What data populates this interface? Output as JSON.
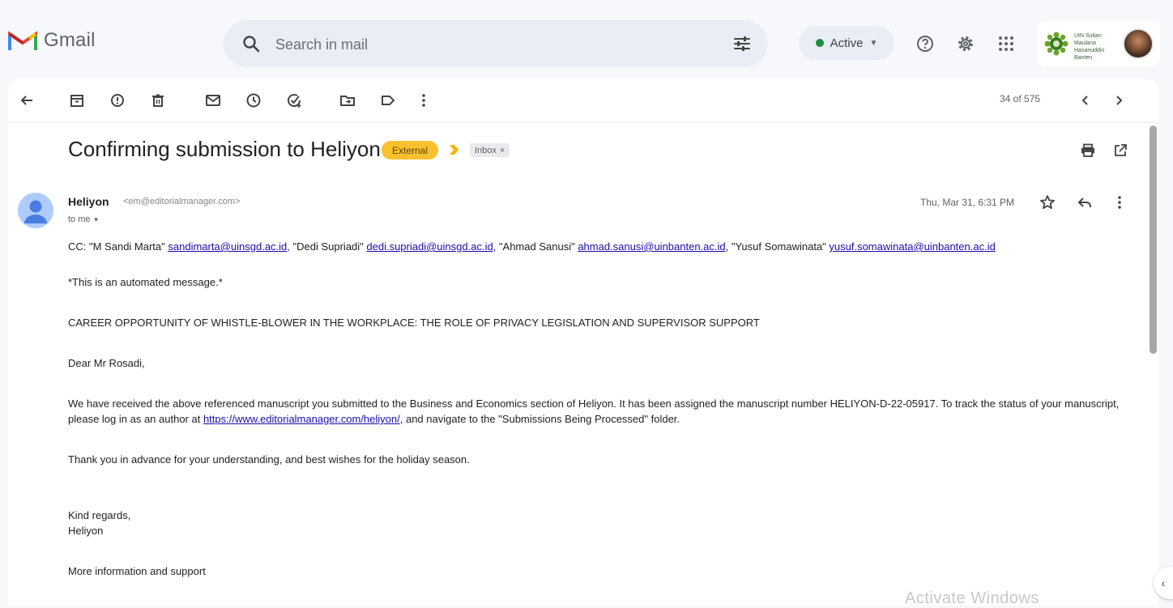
{
  "app": {
    "name": "Gmail",
    "search_placeholder": "Search in mail",
    "status": "Active",
    "status_color": "#1e8e3e",
    "org_name": "UIN Sultan Maulana Hasanuddin Banten"
  },
  "toolbar": {
    "pager": "34 of 575",
    "icons": [
      "back-icon",
      "archive-icon",
      "report-spam-icon",
      "delete-icon",
      "mark-unread-icon",
      "snooze-icon",
      "add-task-icon",
      "move-to-icon",
      "label-icon",
      "more-icon",
      "prev-icon",
      "next-icon"
    ]
  },
  "email": {
    "subject": "Confirming submission to Heliyon",
    "badge_external": "External",
    "badge_inbox": "Inbox",
    "badge_inbox_close": "×",
    "sender_name": "Heliyon",
    "sender_email": "<em@editorialmanager.com>",
    "to_me": "to me",
    "date": "Thu, Mar 31, 6:31 PM",
    "cc": {
      "label": "CC:",
      "r1_name": " \"M Sandi Marta\" ",
      "r1_email": "sandimarta@uinsgd.ac.id",
      "r2_name": ", \"Dedi Supriadi\" ",
      "r2_email": "dedi.supriadi@uinsgd.ac.id",
      "r3_name": ", \"Ahmad Sanusi\" ",
      "r3_email": "ahmad.sanusi@uinbanten.ac.id",
      "r4_name": ", \"Yusuf Somawinata\" ",
      "r4_email": "yusuf.somawinata@uinbanten.ac.id"
    },
    "automated": "*This is an automated message.*",
    "title_line": "CAREER OPPORTUNITY OF WHISTLE-BLOWER IN THE WORKPLACE: THE ROLE OF PRIVACY LEGISLATION AND SUPERVISOR SUPPORT",
    "greeting": "Dear Mr Rosadi,",
    "para1_a": "We have received the above referenced manuscript you submitted to the Business and Economics section of Heliyon. It has been assigned the manuscript number HELIYON-D-22-05917. To track the status of your manuscript, please log in as an author at ",
    "para1_link": "https://www.editorialmanager.com/heliyon/",
    "para1_b": ", and navigate to the \"Submissions Being Processed\" folder.",
    "thanks": "Thank you in advance for your understanding, and best wishes for the holiday season.",
    "regards": "Kind regards,",
    "signature": "Heliyon",
    "more_info": "More information and support"
  },
  "watermark": "Activate Windows"
}
